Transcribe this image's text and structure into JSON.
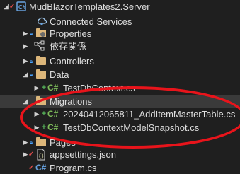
{
  "tree": {
    "project": "MudBlazorTemplates2.Server",
    "items": [
      {
        "label": "Connected Services"
      },
      {
        "label": "Properties"
      },
      {
        "label": "依存関係"
      },
      {
        "label": "Controllers"
      },
      {
        "label": "Data"
      },
      {
        "label": "TestDbContext.cs"
      },
      {
        "label": "Migrations"
      },
      {
        "label": "20240412065811_AddItemMasterTable.cs"
      },
      {
        "label": "TestDbContextModelSnapshot.cs"
      },
      {
        "label": "Pages"
      },
      {
        "label": "appsettings.json"
      },
      {
        "label": "Program.cs"
      }
    ],
    "cs_badge": "C#"
  },
  "colors": {
    "background": "#1f1f1f",
    "folder": "#dcb67a",
    "highlight_ring": "#e8141b",
    "selected_row": "#3a3a3a"
  },
  "icons": {
    "project": "csharp-project-icon",
    "connected_services": "connected-services-icon",
    "dependencies": "dependencies-icon",
    "folder": "folder-icon",
    "cs_file": "csharp-file-icon",
    "json_file": "json-file-icon",
    "lock": "lock-icon",
    "pending_add": "plus-icon",
    "checked_in": "checkmark-icon"
  }
}
